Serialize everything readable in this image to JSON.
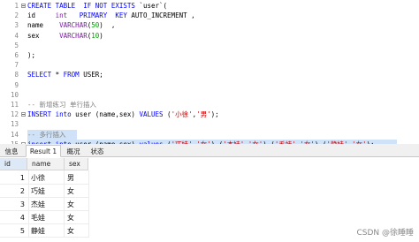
{
  "editor": {
    "gutter": [
      "1",
      "2",
      "3",
      "4",
      "5",
      "6",
      "7",
      "8",
      "9",
      "10",
      "11",
      "12",
      "13",
      "14",
      "15"
    ],
    "lines": [
      [
        [
          "kw",
          "CREATE TABLE  IF NOT EXISTS "
        ],
        [
          "plain",
          "`user`("
        ]
      ],
      [
        [
          "plain",
          "id     "
        ],
        [
          "ty",
          "int"
        ],
        [
          "plain",
          "   "
        ],
        [
          "kw",
          "PRIMARY  KEY"
        ],
        [
          "plain",
          " AUTO_INCREMENT ,"
        ]
      ],
      [
        [
          "plain",
          "name    "
        ],
        [
          "ty",
          "VARCHAR"
        ],
        [
          "plain",
          "("
        ],
        [
          "num",
          "50"
        ],
        [
          "plain",
          ")  ,"
        ]
      ],
      [
        [
          "plain",
          "sex     "
        ],
        [
          "ty",
          "VARCHAR"
        ],
        [
          "plain",
          "("
        ],
        [
          "num",
          "10"
        ],
        [
          "plain",
          ")"
        ]
      ],
      [
        [
          "plain",
          ""
        ]
      ],
      [
        [
          "plain",
          ");"
        ]
      ],
      [
        [
          "plain",
          ""
        ]
      ],
      [
        [
          "kw",
          "SELECT"
        ],
        [
          "plain",
          " * "
        ],
        [
          "kw",
          "FROM"
        ],
        [
          "plain",
          " USER;"
        ]
      ],
      [
        [
          "plain",
          ""
        ]
      ],
      [
        [
          "plain",
          ""
        ]
      ],
      [
        [
          "cm",
          "-- 新增练习 单行插入"
        ]
      ],
      [
        [
          "kw",
          "INSERT into"
        ],
        [
          "plain",
          " user (name,sex) "
        ],
        [
          "kw",
          "VALUES"
        ],
        [
          "plain",
          " ("
        ],
        [
          "str",
          "'小徐'"
        ],
        [
          "plain",
          ","
        ],
        [
          "str",
          "'男'"
        ],
        [
          "plain",
          ");"
        ]
      ],
      [
        [
          "plain",
          ""
        ]
      ],
      [
        [
          "cm",
          "-- 多行插入"
        ]
      ],
      [
        [
          "kw",
          "insert into"
        ],
        [
          "plain",
          " user (name,sex) "
        ],
        [
          "kw",
          "values"
        ],
        [
          "plain",
          " ("
        ],
        [
          "str",
          "'巧娃'"
        ],
        [
          "plain",
          ","
        ],
        [
          "str",
          "'女'"
        ],
        [
          "plain",
          "),("
        ],
        [
          "str",
          "'杰娃'"
        ],
        [
          "plain",
          ","
        ],
        [
          "str",
          "'女'"
        ],
        [
          "plain",
          "),("
        ],
        [
          "str",
          "'毛娃'"
        ],
        [
          "plain",
          ","
        ],
        [
          "str",
          "'女'"
        ],
        [
          "plain",
          "),("
        ],
        [
          "str",
          "'静娃'"
        ],
        [
          "plain",
          ","
        ],
        [
          "str",
          "'女'"
        ],
        [
          "plain",
          ");"
        ]
      ]
    ]
  },
  "tabs": [
    {
      "label": "信息",
      "active": false
    },
    {
      "label": "Result 1",
      "active": true
    },
    {
      "label": "概况",
      "active": false
    },
    {
      "label": "状态",
      "active": false
    }
  ],
  "grid": {
    "columns": [
      "id",
      "name",
      "sex"
    ],
    "rows": [
      {
        "id": "1",
        "name": "小徐",
        "sex": "男"
      },
      {
        "id": "2",
        "name": "巧娃",
        "sex": "女"
      },
      {
        "id": "3",
        "name": "杰娃",
        "sex": "女"
      },
      {
        "id": "4",
        "name": "毛娃",
        "sex": "女"
      },
      {
        "id": "5",
        "name": "静娃",
        "sex": "女"
      }
    ]
  },
  "watermark": "CSDN @徐睡睡",
  "colors": {
    "keyword": "#0000ff",
    "type": "#7a1fa2",
    "number": "#009900",
    "string": "#c50000",
    "comment": "#808080",
    "selection": "#cfe2f7"
  }
}
